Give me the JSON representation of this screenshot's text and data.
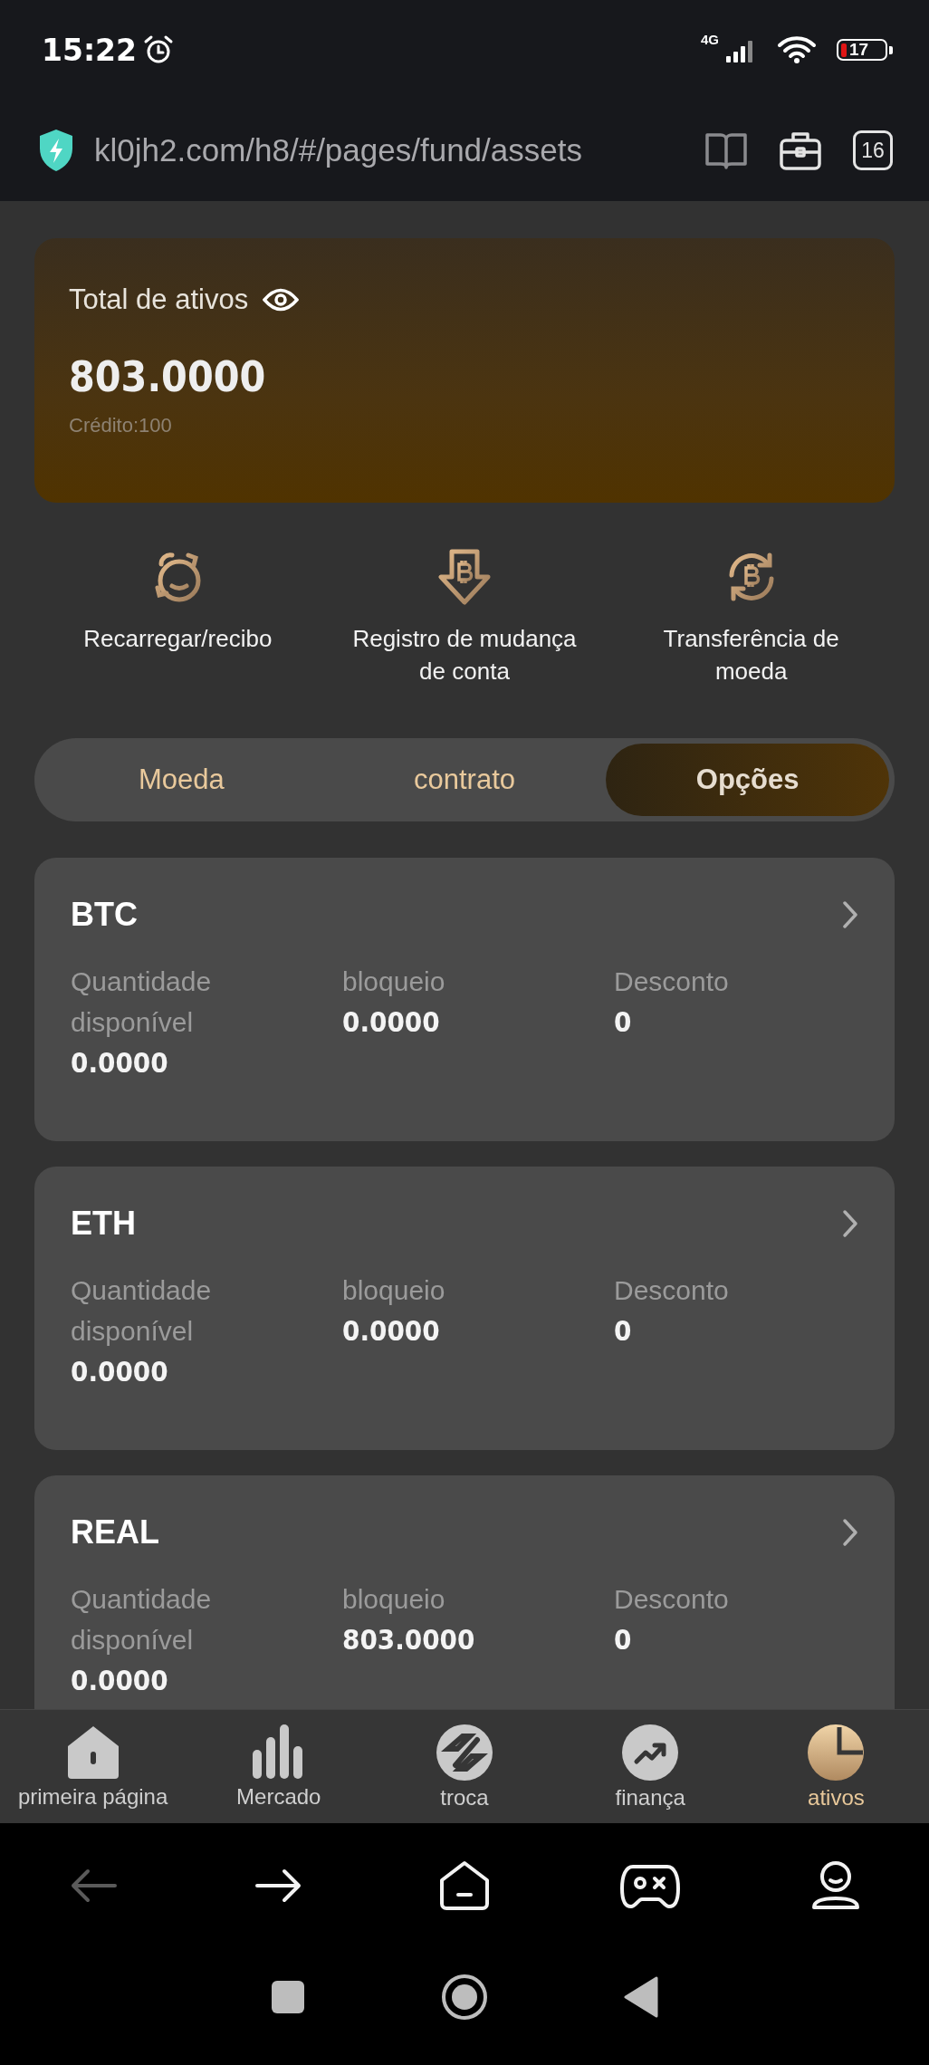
{
  "status_bar": {
    "time": "15:22",
    "network": "4G",
    "battery": "17"
  },
  "browser": {
    "url": "kl0jh2.com/h8/#/pages/fund/assets",
    "tab_count": "16"
  },
  "summary": {
    "title": "Total de ativos",
    "total": "803.0000",
    "credit": "Crédito:100"
  },
  "actions": [
    {
      "kind": "recharge",
      "label": "Recarregar/recibo"
    },
    {
      "kind": "record",
      "label": "Registro de mudança de conta"
    },
    {
      "kind": "transfer",
      "label": "Transferência de moeda"
    }
  ],
  "tabs": [
    {
      "label": "Moeda",
      "selected": false
    },
    {
      "label": "contrato",
      "selected": false
    },
    {
      "label": "Opções",
      "selected": true
    }
  ],
  "assets": [
    {
      "name": "BTC",
      "available_label": "Quantidade disponível",
      "available": "0.0000",
      "locked_label": "bloqueio",
      "locked": "0.0000",
      "discount_label": "Desconto",
      "discount": "0"
    },
    {
      "name": "ETH",
      "available_label": "Quantidade disponível",
      "available": "0.0000",
      "locked_label": "bloqueio",
      "locked": "0.0000",
      "discount_label": "Desconto",
      "discount": "0"
    },
    {
      "name": "REAL",
      "available_label": "Quantidade disponível",
      "available": "0.0000",
      "locked_label": "bloqueio",
      "locked": "803.0000",
      "discount_label": "Desconto",
      "discount": "0"
    }
  ],
  "bottom_nav": [
    {
      "kind": "home",
      "label": "primeira página",
      "selected": false
    },
    {
      "kind": "market",
      "label": "Mercado",
      "selected": false
    },
    {
      "kind": "exchange",
      "label": "troca",
      "selected": false
    },
    {
      "kind": "finance",
      "label": "finança",
      "selected": false
    },
    {
      "kind": "assets",
      "label": "ativos",
      "selected": true
    }
  ],
  "browser_nav": [
    {
      "kind": "back",
      "disabled": true
    },
    {
      "kind": "forward",
      "disabled": false
    },
    {
      "kind": "home",
      "disabled": false
    },
    {
      "kind": "games",
      "disabled": false
    },
    {
      "kind": "profile",
      "disabled": false
    }
  ]
}
